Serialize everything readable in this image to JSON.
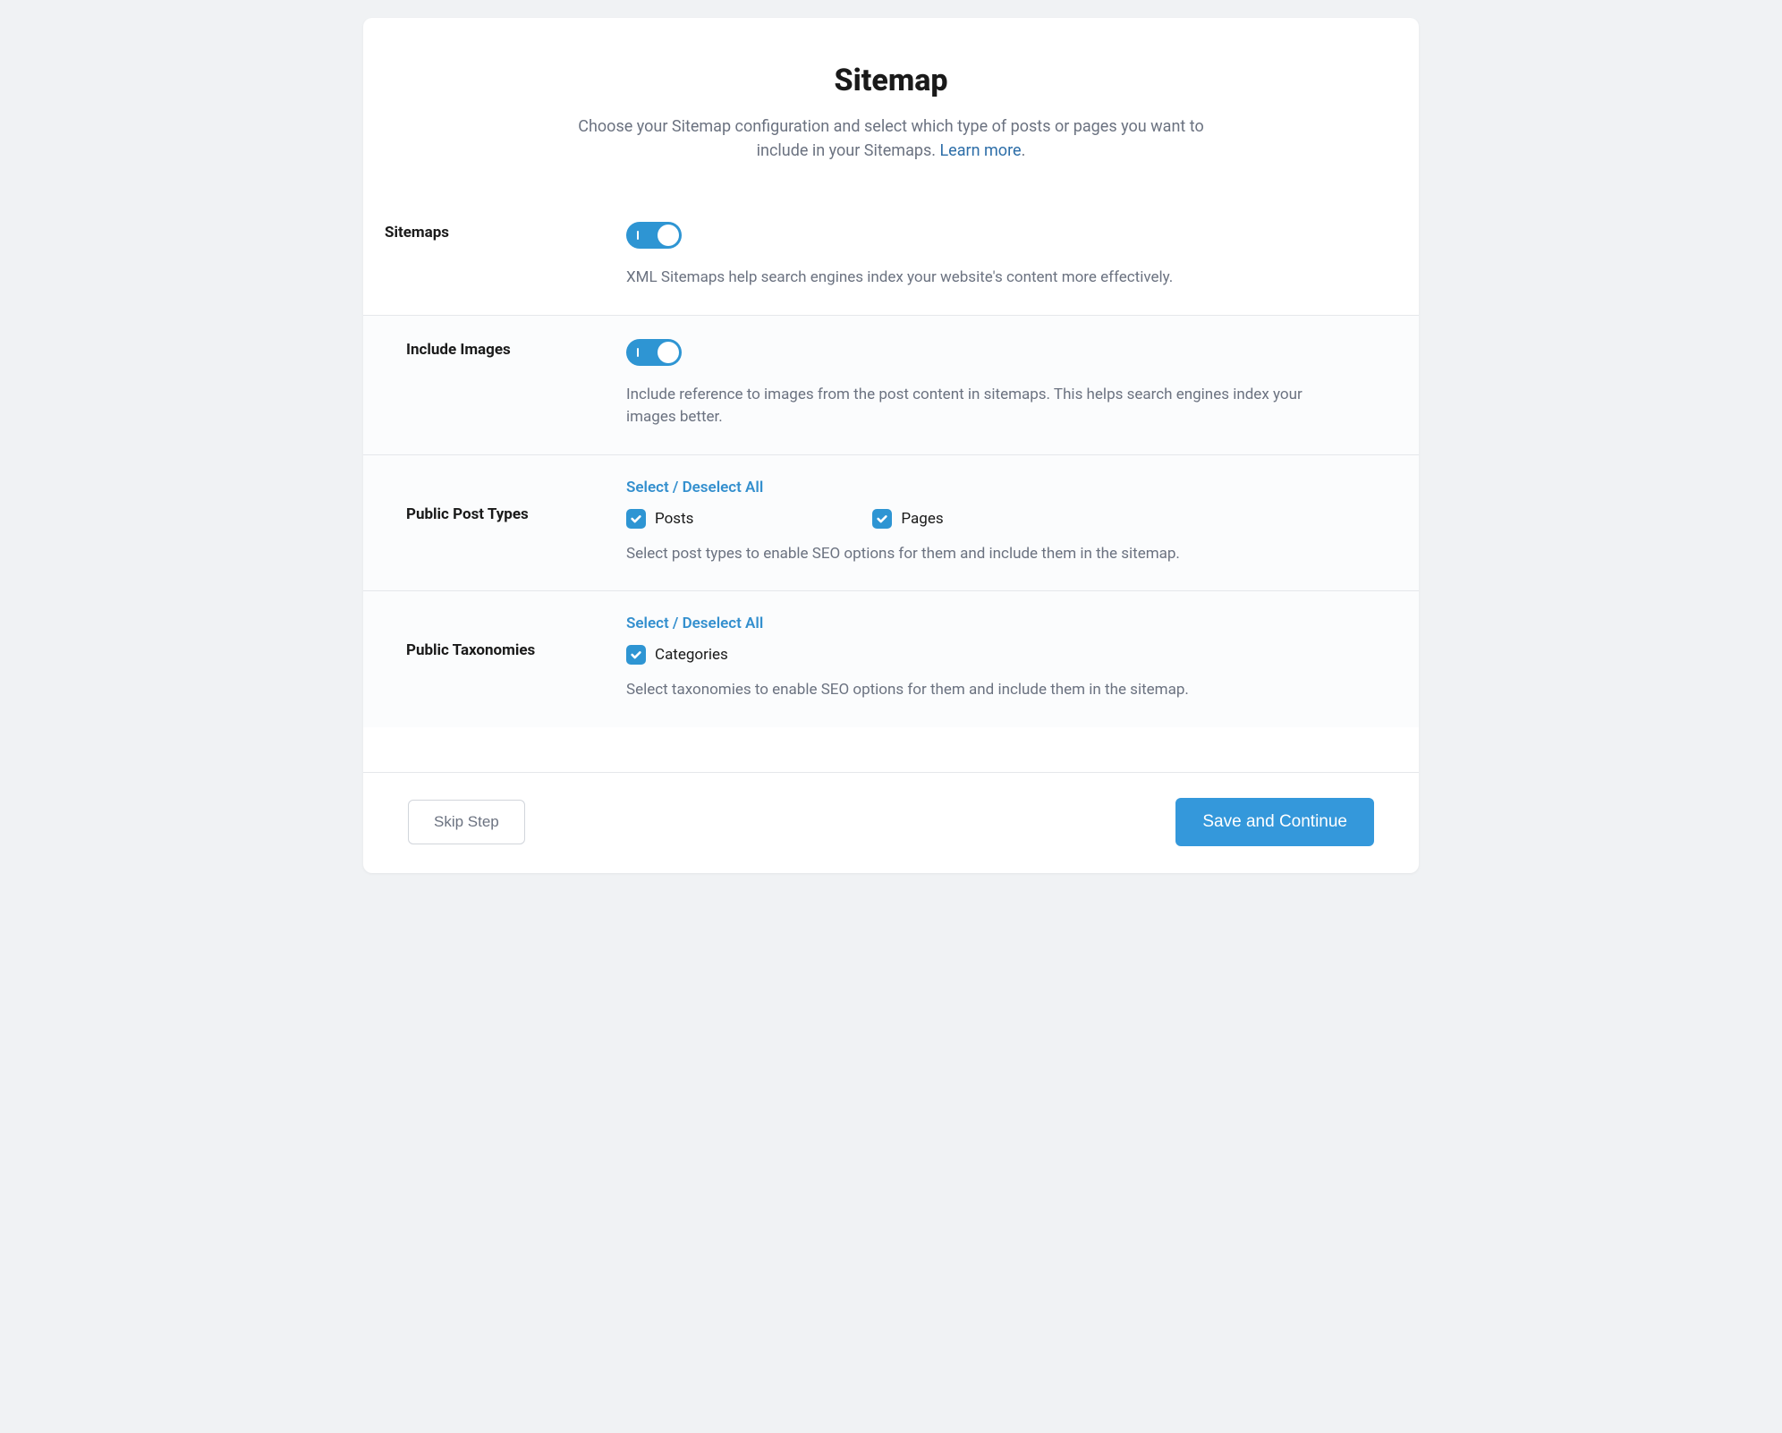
{
  "header": {
    "title": "Sitemap",
    "subtitle_prefix": "Choose your Sitemap configuration and select which type of posts or pages you want to include in your Sitemaps. ",
    "learn_more": "Learn more",
    "subtitle_suffix": "."
  },
  "sections": {
    "sitemaps": {
      "label": "Sitemaps",
      "toggle_on": true,
      "description": "XML Sitemaps help search engines index your website's content more effectively."
    },
    "include_images": {
      "label": "Include Images",
      "toggle_on": true,
      "description": "Include reference to images from the post content in sitemaps. This helps search engines index your images better."
    },
    "post_types": {
      "label": "Public Post Types",
      "select_all": "Select / Deselect All",
      "options": [
        {
          "label": "Posts",
          "checked": true
        },
        {
          "label": "Pages",
          "checked": true
        }
      ],
      "description": "Select post types to enable SEO options for them and include them in the sitemap."
    },
    "taxonomies": {
      "label": "Public Taxonomies",
      "select_all": "Select / Deselect All",
      "options": [
        {
          "label": "Categories",
          "checked": true
        }
      ],
      "description": "Select taxonomies to enable SEO options for them and include them in the sitemap."
    }
  },
  "footer": {
    "skip": "Skip Step",
    "save": "Save and Continue"
  }
}
